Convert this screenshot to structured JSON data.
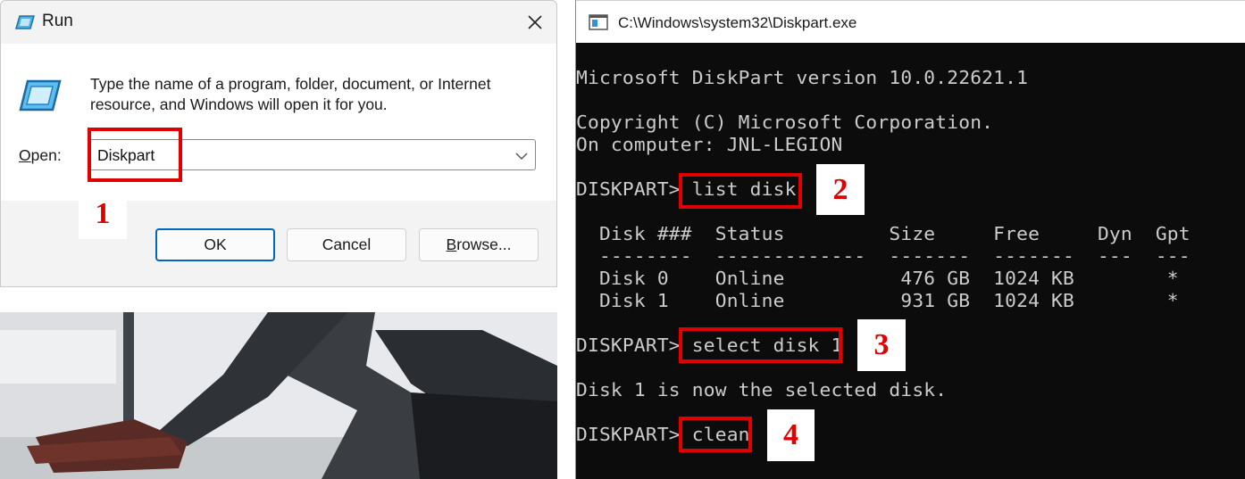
{
  "run_dialog": {
    "title": "Run",
    "description": "Type the name of a program, folder, document, or Internet resource, and Windows will open it for you.",
    "open_label_key": "O",
    "open_label_rest": "pen:",
    "open_value": "Diskpart",
    "buttons": {
      "ok": "OK",
      "cancel": "Cancel",
      "browse_key": "B",
      "browse_rest": "rowse..."
    },
    "icons": [
      "run-app-icon",
      "close-icon",
      "chevron-down-icon"
    ]
  },
  "console": {
    "title": "C:\\Windows\\system32\\Diskpart.exe",
    "lines": {
      "version": "Microsoft DiskPart version 10.0.22621.1",
      "copyright": "Copyright (C) Microsoft Corporation.",
      "computer": "On computer: JNL-LEGION",
      "prompt1": "DISKPART> ",
      "cmd1": "list disk",
      "table_header": "  Disk ###  Status         Size     Free     Dyn  Gpt",
      "table_sep": "  --------  -------------  -------  -------  ---  ---",
      "disk0": "  Disk 0    Online          476 GB  1024 KB        *",
      "disk1": "  Disk 1    Online          931 GB  1024 KB        *",
      "prompt2": "DISKPART> ",
      "cmd2": "select disk 1",
      "selected_msg": "Disk 1 is now the selected disk.",
      "prompt3": "DISKPART> ",
      "cmd3": "clean"
    }
  },
  "step_labels": [
    "1",
    "2",
    "3",
    "4"
  ],
  "colors": {
    "highlight": "#e00000",
    "console_bg": "#0c0c0c",
    "console_text": "#cccccc",
    "accent": "#0067c0"
  }
}
